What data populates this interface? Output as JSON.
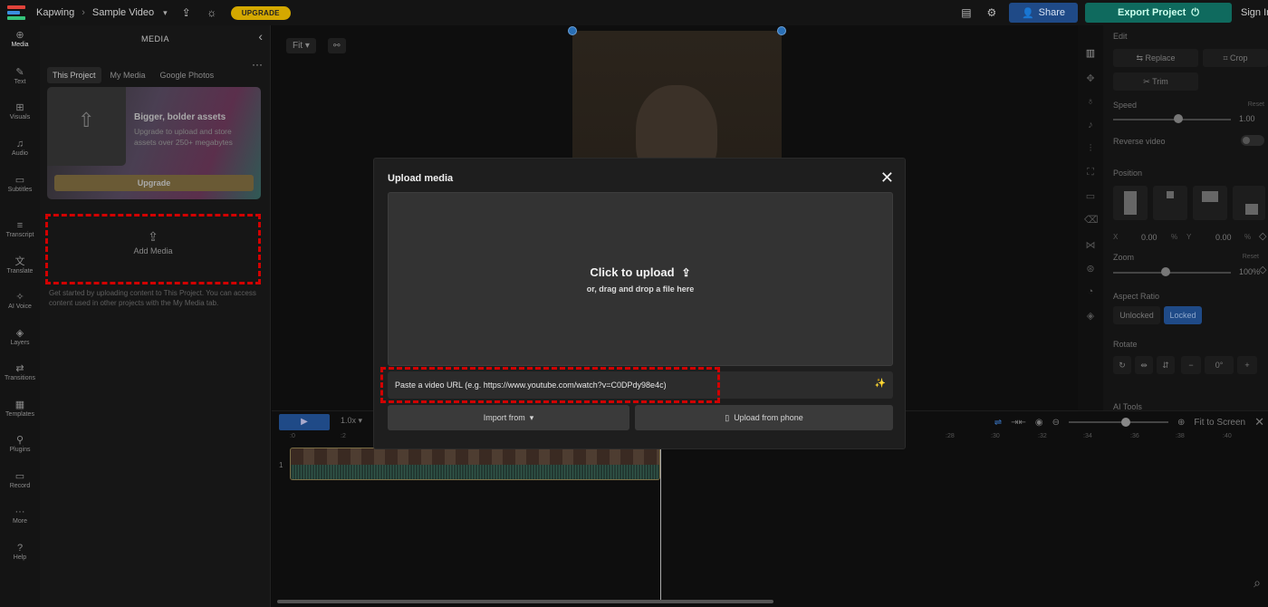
{
  "topbar": {
    "app_name": "Kapwing",
    "project_name": "Sample Video",
    "upgrade_label": "UPGRADE",
    "share_label": "Share",
    "export_label": "Export Project",
    "signin_label": "Sign In"
  },
  "rail": [
    {
      "label": "Media",
      "icon": "media-icon"
    },
    {
      "label": "Text",
      "icon": "text-icon"
    },
    {
      "label": "Visuals",
      "icon": "visuals-icon"
    },
    {
      "label": "Audio",
      "icon": "audio-icon"
    },
    {
      "label": "Subtitles",
      "icon": "subtitles-icon"
    },
    {
      "label": "Transcript",
      "icon": "transcript-icon"
    },
    {
      "label": "Translate",
      "icon": "translate-icon"
    },
    {
      "label": "AI Voice",
      "icon": "ai-voice-icon"
    },
    {
      "label": "Layers",
      "icon": "layers-icon"
    },
    {
      "label": "Transitions",
      "icon": "transitions-icon"
    },
    {
      "label": "Templates",
      "icon": "templates-icon"
    },
    {
      "label": "Plugins",
      "icon": "plugins-icon"
    },
    {
      "label": "Record",
      "icon": "record-icon"
    },
    {
      "label": "More",
      "icon": "more-icon"
    },
    {
      "label": "Help",
      "icon": "help-icon"
    }
  ],
  "media_panel": {
    "title": "MEDIA",
    "tabs": [
      "This Project",
      "My Media",
      "Google Photos"
    ],
    "promo_heading": "Bigger, bolder assets",
    "promo_text": "Upgrade to upload and store assets over 250+ megabytes",
    "promo_button": "Upgrade",
    "add_media_label": "Add Media",
    "help_text": "Get started by uploading content to This Project. You can access content used in other projects with the My Media tab."
  },
  "canvas": {
    "fit_label": "Fit"
  },
  "right_panel": {
    "edit_label": "Edit",
    "replace_label": "Replace",
    "crop_label": "Crop",
    "trim_label": "Trim",
    "speed_label": "Speed",
    "reset_label": "Reset",
    "speed_value": "1.00",
    "reverse_label": "Reverse video",
    "position_label": "Position",
    "x_label": "X",
    "x_value": "0.00",
    "y_label": "Y",
    "y_value": "0.00",
    "percent": "%",
    "zoom_label": "Zoom",
    "zoom_value": "100%",
    "aspect_label": "Aspect Ratio",
    "unlocked_label": "Unlocked",
    "locked_label": "Locked",
    "rotate_label": "Rotate",
    "ai_tools_label": "AI Tools"
  },
  "timeline": {
    "speed": "1.0x",
    "fit_to_screen": "Fit to Screen",
    "track_number": "1",
    "ruler": [
      ":0",
      ":2",
      ":28",
      ":30",
      ":32",
      ":34",
      ":36",
      ":38",
      ":40"
    ]
  },
  "modal": {
    "title": "Upload media",
    "click_to_upload": "Click to upload",
    "drag_drop": "or, drag and drop a file here",
    "url_placeholder": "Paste a video URL (e.g. https://www.youtube.com/watch?v=C0DPdy98e4c)",
    "import_from": "Import from",
    "upload_from_phone": "Upload from phone"
  },
  "colors": {
    "highlight": "#d10000",
    "share": "#1f4a87",
    "export": "#0f6a5e",
    "upgrade": "#d4a800"
  }
}
